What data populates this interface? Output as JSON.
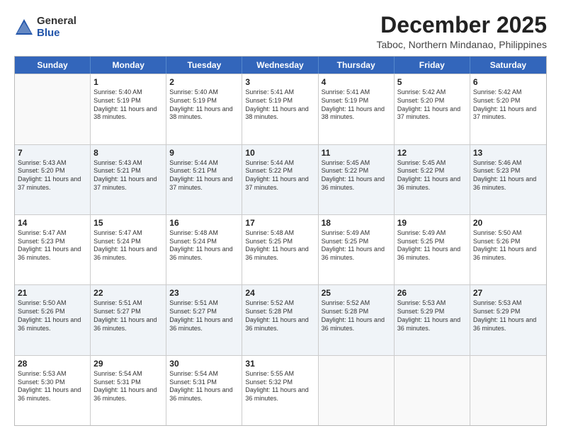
{
  "logo": {
    "general": "General",
    "blue": "Blue"
  },
  "title": "December 2025",
  "location": "Taboc, Northern Mindanao, Philippines",
  "days": [
    "Sunday",
    "Monday",
    "Tuesday",
    "Wednesday",
    "Thursday",
    "Friday",
    "Saturday"
  ],
  "weeks": [
    [
      {
        "day": "",
        "sunrise": "",
        "sunset": "",
        "daylight": ""
      },
      {
        "day": "1",
        "sunrise": "Sunrise: 5:40 AM",
        "sunset": "Sunset: 5:19 PM",
        "daylight": "Daylight: 11 hours and 38 minutes."
      },
      {
        "day": "2",
        "sunrise": "Sunrise: 5:40 AM",
        "sunset": "Sunset: 5:19 PM",
        "daylight": "Daylight: 11 hours and 38 minutes."
      },
      {
        "day": "3",
        "sunrise": "Sunrise: 5:41 AM",
        "sunset": "Sunset: 5:19 PM",
        "daylight": "Daylight: 11 hours and 38 minutes."
      },
      {
        "day": "4",
        "sunrise": "Sunrise: 5:41 AM",
        "sunset": "Sunset: 5:19 PM",
        "daylight": "Daylight: 11 hours and 38 minutes."
      },
      {
        "day": "5",
        "sunrise": "Sunrise: 5:42 AM",
        "sunset": "Sunset: 5:20 PM",
        "daylight": "Daylight: 11 hours and 37 minutes."
      },
      {
        "day": "6",
        "sunrise": "Sunrise: 5:42 AM",
        "sunset": "Sunset: 5:20 PM",
        "daylight": "Daylight: 11 hours and 37 minutes."
      }
    ],
    [
      {
        "day": "7",
        "sunrise": "Sunrise: 5:43 AM",
        "sunset": "Sunset: 5:20 PM",
        "daylight": "Daylight: 11 hours and 37 minutes."
      },
      {
        "day": "8",
        "sunrise": "Sunrise: 5:43 AM",
        "sunset": "Sunset: 5:21 PM",
        "daylight": "Daylight: 11 hours and 37 minutes."
      },
      {
        "day": "9",
        "sunrise": "Sunrise: 5:44 AM",
        "sunset": "Sunset: 5:21 PM",
        "daylight": "Daylight: 11 hours and 37 minutes."
      },
      {
        "day": "10",
        "sunrise": "Sunrise: 5:44 AM",
        "sunset": "Sunset: 5:22 PM",
        "daylight": "Daylight: 11 hours and 37 minutes."
      },
      {
        "day": "11",
        "sunrise": "Sunrise: 5:45 AM",
        "sunset": "Sunset: 5:22 PM",
        "daylight": "Daylight: 11 hours and 36 minutes."
      },
      {
        "day": "12",
        "sunrise": "Sunrise: 5:45 AM",
        "sunset": "Sunset: 5:22 PM",
        "daylight": "Daylight: 11 hours and 36 minutes."
      },
      {
        "day": "13",
        "sunrise": "Sunrise: 5:46 AM",
        "sunset": "Sunset: 5:23 PM",
        "daylight": "Daylight: 11 hours and 36 minutes."
      }
    ],
    [
      {
        "day": "14",
        "sunrise": "Sunrise: 5:47 AM",
        "sunset": "Sunset: 5:23 PM",
        "daylight": "Daylight: 11 hours and 36 minutes."
      },
      {
        "day": "15",
        "sunrise": "Sunrise: 5:47 AM",
        "sunset": "Sunset: 5:24 PM",
        "daylight": "Daylight: 11 hours and 36 minutes."
      },
      {
        "day": "16",
        "sunrise": "Sunrise: 5:48 AM",
        "sunset": "Sunset: 5:24 PM",
        "daylight": "Daylight: 11 hours and 36 minutes."
      },
      {
        "day": "17",
        "sunrise": "Sunrise: 5:48 AM",
        "sunset": "Sunset: 5:25 PM",
        "daylight": "Daylight: 11 hours and 36 minutes."
      },
      {
        "day": "18",
        "sunrise": "Sunrise: 5:49 AM",
        "sunset": "Sunset: 5:25 PM",
        "daylight": "Daylight: 11 hours and 36 minutes."
      },
      {
        "day": "19",
        "sunrise": "Sunrise: 5:49 AM",
        "sunset": "Sunset: 5:25 PM",
        "daylight": "Daylight: 11 hours and 36 minutes."
      },
      {
        "day": "20",
        "sunrise": "Sunrise: 5:50 AM",
        "sunset": "Sunset: 5:26 PM",
        "daylight": "Daylight: 11 hours and 36 minutes."
      }
    ],
    [
      {
        "day": "21",
        "sunrise": "Sunrise: 5:50 AM",
        "sunset": "Sunset: 5:26 PM",
        "daylight": "Daylight: 11 hours and 36 minutes."
      },
      {
        "day": "22",
        "sunrise": "Sunrise: 5:51 AM",
        "sunset": "Sunset: 5:27 PM",
        "daylight": "Daylight: 11 hours and 36 minutes."
      },
      {
        "day": "23",
        "sunrise": "Sunrise: 5:51 AM",
        "sunset": "Sunset: 5:27 PM",
        "daylight": "Daylight: 11 hours and 36 minutes."
      },
      {
        "day": "24",
        "sunrise": "Sunrise: 5:52 AM",
        "sunset": "Sunset: 5:28 PM",
        "daylight": "Daylight: 11 hours and 36 minutes."
      },
      {
        "day": "25",
        "sunrise": "Sunrise: 5:52 AM",
        "sunset": "Sunset: 5:28 PM",
        "daylight": "Daylight: 11 hours and 36 minutes."
      },
      {
        "day": "26",
        "sunrise": "Sunrise: 5:53 AM",
        "sunset": "Sunset: 5:29 PM",
        "daylight": "Daylight: 11 hours and 36 minutes."
      },
      {
        "day": "27",
        "sunrise": "Sunrise: 5:53 AM",
        "sunset": "Sunset: 5:29 PM",
        "daylight": "Daylight: 11 hours and 36 minutes."
      }
    ],
    [
      {
        "day": "28",
        "sunrise": "Sunrise: 5:53 AM",
        "sunset": "Sunset: 5:30 PM",
        "daylight": "Daylight: 11 hours and 36 minutes."
      },
      {
        "day": "29",
        "sunrise": "Sunrise: 5:54 AM",
        "sunset": "Sunset: 5:31 PM",
        "daylight": "Daylight: 11 hours and 36 minutes."
      },
      {
        "day": "30",
        "sunrise": "Sunrise: 5:54 AM",
        "sunset": "Sunset: 5:31 PM",
        "daylight": "Daylight: 11 hours and 36 minutes."
      },
      {
        "day": "31",
        "sunrise": "Sunrise: 5:55 AM",
        "sunset": "Sunset: 5:32 PM",
        "daylight": "Daylight: 11 hours and 36 minutes."
      },
      {
        "day": "",
        "sunrise": "",
        "sunset": "",
        "daylight": ""
      },
      {
        "day": "",
        "sunrise": "",
        "sunset": "",
        "daylight": ""
      },
      {
        "day": "",
        "sunrise": "",
        "sunset": "",
        "daylight": ""
      }
    ]
  ]
}
